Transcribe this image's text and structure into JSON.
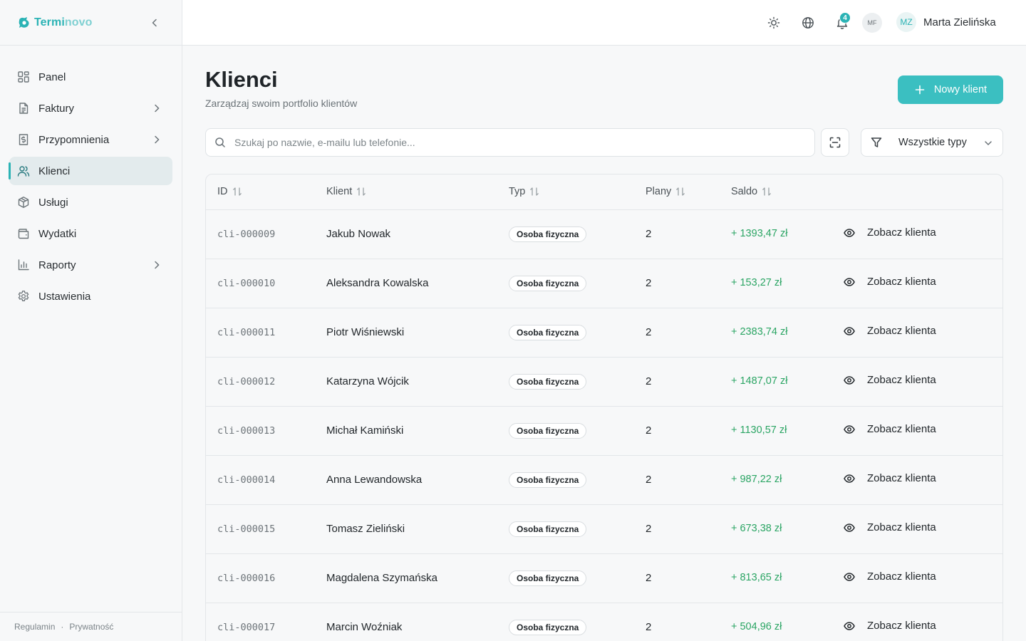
{
  "brand": {
    "name_part1": "Termi",
    "name_part2": "novo"
  },
  "sidebar": {
    "items": [
      {
        "label": "Panel",
        "icon": "dashboard-icon",
        "has_submenu": false,
        "active": false
      },
      {
        "label": "Faktury",
        "icon": "document-icon",
        "has_submenu": true,
        "active": false
      },
      {
        "label": "Przypomnienia",
        "icon": "receipt-dollar-icon",
        "has_submenu": true,
        "active": false
      },
      {
        "label": "Klienci",
        "icon": "users-icon",
        "has_submenu": false,
        "active": true
      },
      {
        "label": "Usługi",
        "icon": "box-icon",
        "has_submenu": false,
        "active": false
      },
      {
        "label": "Wydatki",
        "icon": "wallet-icon",
        "has_submenu": false,
        "active": false
      },
      {
        "label": "Raporty",
        "icon": "bar-chart-icon",
        "has_submenu": true,
        "active": false
      },
      {
        "label": "Ustawienia",
        "icon": "gear-icon",
        "has_submenu": false,
        "active": false
      }
    ],
    "footer": {
      "terms": "Regulamin",
      "separator": "·",
      "privacy": "Prywatność"
    }
  },
  "topbar": {
    "notification_count": "4",
    "secondary_avatar": "MF",
    "user_initials": "MZ",
    "user_name": "Marta Zielińska"
  },
  "page": {
    "title": "Klienci",
    "subtitle": "Zarządzaj swoim portfolio klientów",
    "new_button": "Nowy klient"
  },
  "search": {
    "placeholder": "Szukaj po nazwie, e-mailu lub telefonie..."
  },
  "filter": {
    "selected": "Wszystkie typy"
  },
  "colors": {
    "accent": "#3bbfc1",
    "brand": "#2bb3b5",
    "positive": "#2ba564"
  },
  "table": {
    "columns": [
      "ID",
      "Klient",
      "Typ",
      "Plany",
      "Saldo"
    ],
    "view_label": "Zobacz klienta",
    "rows": [
      {
        "id": "cli-000009",
        "name": "Jakub Nowak",
        "type": "Osoba fizyczna",
        "plans": "2",
        "balance": "+ 1393,47 zł"
      },
      {
        "id": "cli-000010",
        "name": "Aleksandra Kowalska",
        "type": "Osoba fizyczna",
        "plans": "2",
        "balance": "+ 153,27 zł"
      },
      {
        "id": "cli-000011",
        "name": "Piotr Wiśniewski",
        "type": "Osoba fizyczna",
        "plans": "2",
        "balance": "+ 2383,74 zł"
      },
      {
        "id": "cli-000012",
        "name": "Katarzyna Wójcik",
        "type": "Osoba fizyczna",
        "plans": "2",
        "balance": "+ 1487,07 zł"
      },
      {
        "id": "cli-000013",
        "name": "Michał Kamiński",
        "type": "Osoba fizyczna",
        "plans": "2",
        "balance": "+ 1130,57 zł"
      },
      {
        "id": "cli-000014",
        "name": "Anna Lewandowska",
        "type": "Osoba fizyczna",
        "plans": "2",
        "balance": "+ 987,22 zł"
      },
      {
        "id": "cli-000015",
        "name": "Tomasz Zieliński",
        "type": "Osoba fizyczna",
        "plans": "2",
        "balance": "+ 673,38 zł"
      },
      {
        "id": "cli-000016",
        "name": "Magdalena Szymańska",
        "type": "Osoba fizyczna",
        "plans": "2",
        "balance": "+ 813,65 zł"
      },
      {
        "id": "cli-000017",
        "name": "Marcin Woźniak",
        "type": "Osoba fizyczna",
        "plans": "2",
        "balance": "+ 504,96 zł"
      }
    ]
  }
}
